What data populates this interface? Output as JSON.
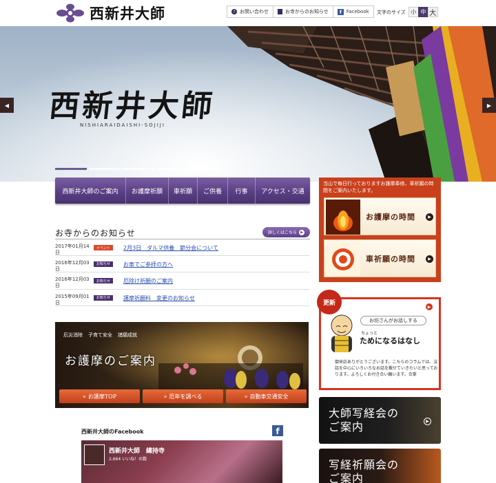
{
  "header": {
    "logo_text": "西新井大師",
    "utility": {
      "contact_label": "お問い合わせ",
      "news_label": "お寺からのお知らせ",
      "facebook_label": "Facebook"
    },
    "font_size": {
      "label": "文字のサイズ",
      "small": "小",
      "medium": "中",
      "large": "大",
      "selected": "中"
    }
  },
  "hero": {
    "title": "西新井大師",
    "subtitle": "NISHIARAIDAISHI-SOJIJI",
    "prev_icon": "chevron-left-icon",
    "next_icon": "chevron-right-icon",
    "slide_count": 5,
    "active_slide": 1
  },
  "nav": {
    "items": [
      {
        "label": "西新井大師のご案内"
      },
      {
        "label": "お護摩祈願"
      },
      {
        "label": "車祈願"
      },
      {
        "label": "ご供養"
      },
      {
        "label": "行事"
      },
      {
        "label": "アクセス・交通"
      }
    ]
  },
  "news": {
    "title": "お寺からのお知らせ",
    "more_label": "詳しくはこちら",
    "items": [
      {
        "date": "2017年01月14日",
        "tag": "イベント",
        "tag_type": "event",
        "title": "2月3日　ダルマ供養　節分会について"
      },
      {
        "date": "2016年12月03日",
        "tag": "お知らせ",
        "tag_type": "notice",
        "title": "お車でご参拝の方へ"
      },
      {
        "date": "2016年12月03日",
        "tag": "お知らせ",
        "tag_type": "notice",
        "title": "厄除け祈願のご案内"
      },
      {
        "date": "2015年09月01日",
        "tag": "お知らせ",
        "tag_type": "notice",
        "title": "護摩祈願料　変更のお知らせ"
      }
    ]
  },
  "goma_banner": {
    "tags": [
      "厄災消除",
      "子育て安全",
      "諸願成就"
    ],
    "title": "お護摩のご案内",
    "buttons": [
      {
        "label": "お護摩TOP"
      },
      {
        "label": "厄年を調べる"
      },
      {
        "label": "自動車交通安全"
      }
    ]
  },
  "facebook": {
    "title": "西新井大師のFacebook",
    "page_name": "西新井大師　總持寺",
    "likes": "2,664 いいね！の数"
  },
  "sidebar": {
    "intro": "当山で毎日行っておりますお護摩奉修、車祈願の時間をご案内いたします。",
    "goma_time": "お護摩の時間",
    "kuruma_time": "車祈願の時間",
    "column": {
      "badge": "更新",
      "speech": "お坊さんがお話しする",
      "sub": "ちょっと",
      "title": "ためになるはなし",
      "text": "御来訪ありがとうございます。こちらのコラムでは、法話を中心にいろいろなお話を載せていきたいと思っております。よろしくお付き合い願います。合掌"
    },
    "shakyo": "大師写経会のご案内",
    "shakyo_gan": "写経祈願会のご案内"
  },
  "colors": {
    "purple": "#5a3f85",
    "accent_red": "#c9401c",
    "orange_button": "#d9552a",
    "link_blue": "#2a4fb0"
  }
}
